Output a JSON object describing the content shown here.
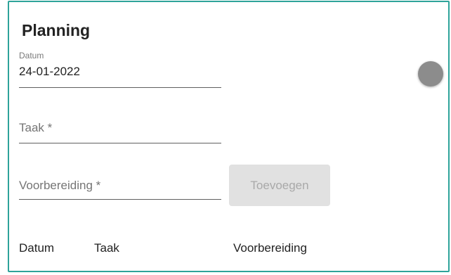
{
  "card": {
    "title": "Planning"
  },
  "form": {
    "datum": {
      "label": "Datum",
      "value": "24-01-2022"
    },
    "taak": {
      "placeholder": "Taak *"
    },
    "voorbereiding": {
      "placeholder": "Voorbereiding *"
    },
    "add_button_label": "Toevoegen"
  },
  "toggle": {
    "state": "off",
    "thumb_color": "#8c8c8c"
  },
  "table": {
    "columns": [
      "Datum",
      "Taak",
      "Voorbereiding"
    ]
  },
  "colors": {
    "border_accent": "#2ea39a",
    "button_disabled_bg": "#e1e1e1",
    "button_disabled_text": "#a9a9a9"
  }
}
